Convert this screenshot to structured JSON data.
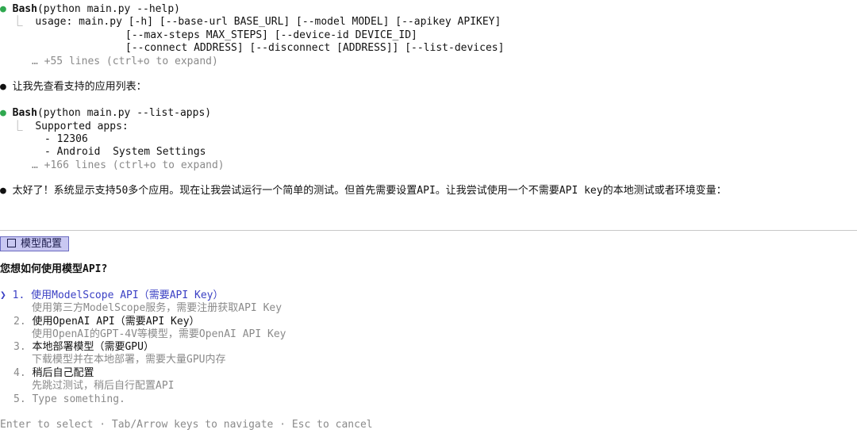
{
  "session": {
    "block1": {
      "dot": "●",
      "tool": "Bash",
      "command": "(python main.py --help)",
      "lines": [
        "usage: main.py [-h] [--base-url BASE_URL] [--model MODEL] [--apikey APIKEY]",
        "[--max-steps MAX_STEPS] [--device-id DEVICE_ID]",
        "[--connect ADDRESS] [--disconnect [ADDRESS]] [--list-devices]"
      ],
      "more": "… +55 lines (ctrl+o to expand)"
    },
    "msg1": "让我先查看支持的应用列表：",
    "block2": {
      "dot": "●",
      "tool": "Bash",
      "command": "(python main.py --list-apps)",
      "lines": [
        "Supported apps:",
        "- 12306",
        "- Android  System Settings"
      ],
      "more": "… +166 lines (ctrl+o to expand)"
    },
    "msg2": "太好了！系统显示支持50多个应用。现在让我尝试运行一个简单的测试。但首先需要设置API。让我尝试使用一个不需要API key的本地测试或者环境变量："
  },
  "dialog": {
    "tab_label": "模型配置",
    "question": "您想如何使用模型API?",
    "cursor": "❯",
    "options": [
      {
        "num": "1.",
        "label": "使用ModelScope API（需要API Key）",
        "desc": "使用第三方ModelScope服务，需要注册获取API Key"
      },
      {
        "num": "2.",
        "label": "使用OpenAI API（需要API Key）",
        "desc": "使用OpenAI的GPT-4V等模型，需要OpenAI API Key"
      },
      {
        "num": "3.",
        "label": "本地部署模型（需要GPU）",
        "desc": "下载模型并在本地部署，需要大量GPU内存"
      },
      {
        "num": "4.",
        "label": "稍后自己配置",
        "desc": "先跳过测试，稍后自行配置API"
      },
      {
        "num": "5.",
        "label": "Type something.",
        "desc": ""
      }
    ],
    "footer": "Enter to select · Tab/Arrow keys to navigate · Esc to cancel"
  },
  "colors": {
    "selected": "#3b40c4",
    "tab_bg": "#c9c8f2",
    "dot_green": "#2fa84f"
  }
}
